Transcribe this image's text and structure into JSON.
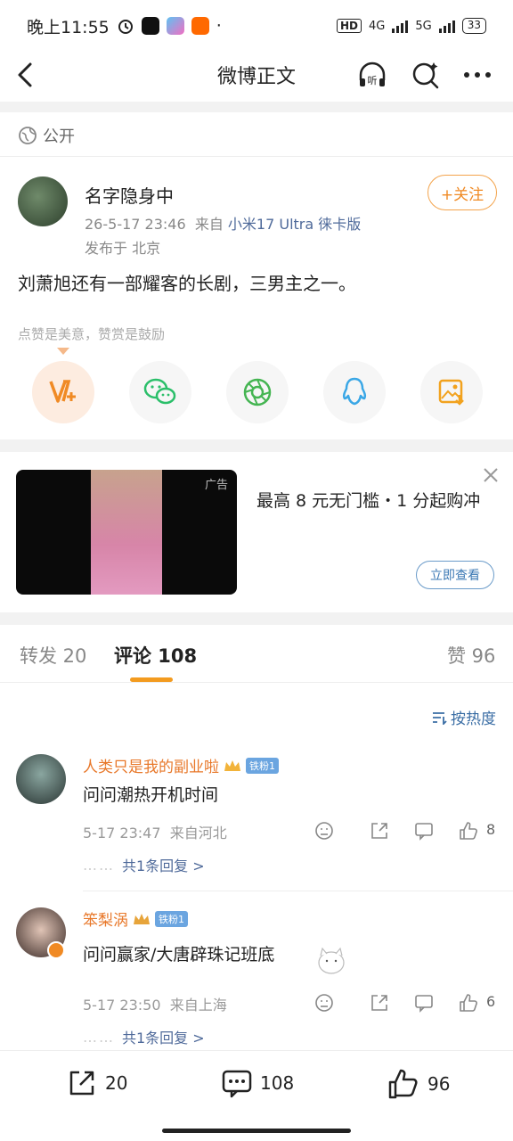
{
  "status_bar": {
    "time": "晚上11:55",
    "network_4g": "4G",
    "network_5g": "5G",
    "hd_label": "HD",
    "battery": "33"
  },
  "nav": {
    "title": "微博正文"
  },
  "visibility": {
    "label": "公开"
  },
  "post": {
    "author": "名字隐身中",
    "time": "26-5-17 23:46",
    "from_prefix": "来自",
    "device": "小米17 Ultra 徕卡版",
    "location": "发布于 北京",
    "follow_label": "+关注",
    "text": "刘萧旭还有一部耀客的长剧，三男主之一。"
  },
  "reward": {
    "hint": "点赞是美意，赞赏是鼓励"
  },
  "ad": {
    "tag": "广告",
    "text": "最高 8 元无门槛・1 分起购冲",
    "button": "立即查看"
  },
  "tabs": {
    "repost": "转发 20",
    "comments": "评论 108",
    "likes": "赞 96"
  },
  "sort": {
    "label": "按热度"
  },
  "comments": [
    {
      "name": "人类只是我的副业啦",
      "fan_badge": "铁粉1",
      "text": "问问潮热开机时间",
      "time": "5-17 23:47",
      "location": "来自河北",
      "likes": "8",
      "replies": "共1条回复 >"
    },
    {
      "name": "笨梨涡",
      "fan_badge": "铁粉1",
      "text": "问问赢家/大唐辟珠记班底",
      "time": "5-17 23:50",
      "location": "来自上海",
      "likes": "6",
      "replies": "共1条回复 >"
    }
  ],
  "bottom_bar": {
    "reposts": "20",
    "comments": "108",
    "likes": "96"
  },
  "colors": {
    "accent_orange": "#f39b1f",
    "link_blue": "#4f6a9a",
    "name_orange": "#e8782a"
  }
}
